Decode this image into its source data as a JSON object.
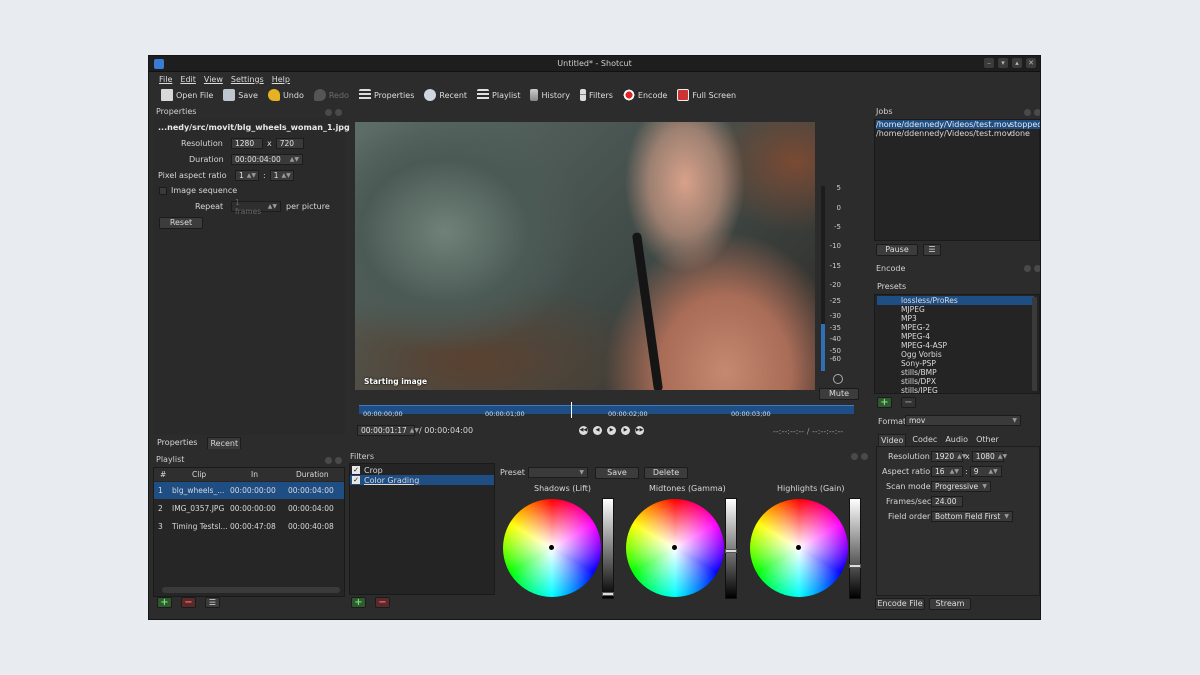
{
  "window": {
    "title": "Untitled* - Shotcut",
    "controls": [
      "–",
      "▾",
      "▴",
      "✕"
    ]
  },
  "menu": [
    "File",
    "Edit",
    "View",
    "Settings",
    "Help"
  ],
  "toolbar": {
    "open": "Open File",
    "save": "Save",
    "undo": "Undo",
    "redo": "Redo",
    "properties": "Properties",
    "recent": "Recent",
    "playlist": "Playlist",
    "history": "History",
    "filters": "Filters",
    "encode": "Encode",
    "fullscreen": "Full Screen"
  },
  "properties": {
    "title": "Properties",
    "filename": "...nedy/src/movit/blg_wheels_woman_1.jpg",
    "resolution_label": "Resolution",
    "res_w": "1280",
    "res_x": "x",
    "res_h": "720",
    "duration_label": "Duration",
    "duration": "00:00:04:00",
    "par_label": "Pixel aspect ratio",
    "par_num": "1",
    "par_colon": ":",
    "par_den": "1",
    "image_sequence": "Image sequence",
    "repeat_label": "Repeat",
    "repeat_value": "1 frames",
    "per_picture": "per picture",
    "reset": "Reset",
    "tab_properties": "Properties",
    "tab_recent": "Recent"
  },
  "playlist": {
    "title": "Playlist",
    "headers": [
      "#",
      "Clip",
      "In",
      "Duration"
    ],
    "rows": [
      {
        "num": "1",
        "clip": "blg_wheels_...",
        "in": "00:00:00:00",
        "duration": "00:00:04:00"
      },
      {
        "num": "2",
        "clip": "IMG_0357.JPG",
        "in": "00:00:00:00",
        "duration": "00:00:04:00"
      },
      {
        "num": "3",
        "clip": "Timing Testsl...",
        "in": "00:00:47:08",
        "duration": "00:00:40:08"
      }
    ]
  },
  "viewer": {
    "caption": "Starting image",
    "meter_labels": [
      "5",
      "0",
      "-5",
      "-10",
      "-15",
      "-20",
      "-25",
      "-30",
      "-35",
      "-40",
      "-50",
      "-60"
    ],
    "mute": "Mute",
    "timecode": "00:00:01:17",
    "total": "/ 00:00:04:00",
    "in_out": "--:--:--:-- / --:--:--:--",
    "ruler_ticks": [
      "00:00:00;00",
      "00:00:01;00",
      "00:00:02;00",
      "00:00:03;00"
    ]
  },
  "filters": {
    "title": "Filters",
    "items": [
      {
        "label": "Crop",
        "checked": true
      },
      {
        "label": "Color Grading",
        "checked": true
      }
    ],
    "preset_label": "Preset",
    "save": "Save",
    "delete": "Delete",
    "wheels": [
      "Shadows (Lift)",
      "Midtones (Gamma)",
      "Highlights (Gain)"
    ]
  },
  "jobs": {
    "title": "Jobs",
    "rows": [
      {
        "path": "/home/ddennedy/Videos/test.mov",
        "status": "stopped"
      },
      {
        "path": "/home/ddennedy/Videos/test.mov",
        "status": "done"
      }
    ],
    "pause": "Pause"
  },
  "encode": {
    "title": "Encode",
    "presets_label": "Presets",
    "presets": [
      "lossless/ProRes",
      "MJPEG",
      "MP3",
      "MPEG-2",
      "MPEG-4",
      "MPEG-4-ASP",
      "Ogg Vorbis",
      "Sony-PSP",
      "stills/BMP",
      "stills/DPX",
      "stills/JPEG"
    ],
    "format_label": "Format",
    "format": "mov",
    "tabs": [
      "Video",
      "Codec",
      "Audio",
      "Other"
    ],
    "resolution_label": "Resolution",
    "res_w": "1920",
    "res_x": "x",
    "res_h": "1080",
    "aspect_label": "Aspect ratio",
    "aspect_w": "16",
    "aspect_colon": ":",
    "aspect_h": "9",
    "scan_label": "Scan mode",
    "scan": "Progressive",
    "fps_label": "Frames/sec",
    "fps": "24.00",
    "field_label": "Field order",
    "field": "Bottom Field First",
    "encode_file": "Encode File",
    "stream": "Stream"
  },
  "colors": {
    "accent": "#1f4e85",
    "background": "#2c2c2c",
    "page": "#e8ecf1"
  }
}
